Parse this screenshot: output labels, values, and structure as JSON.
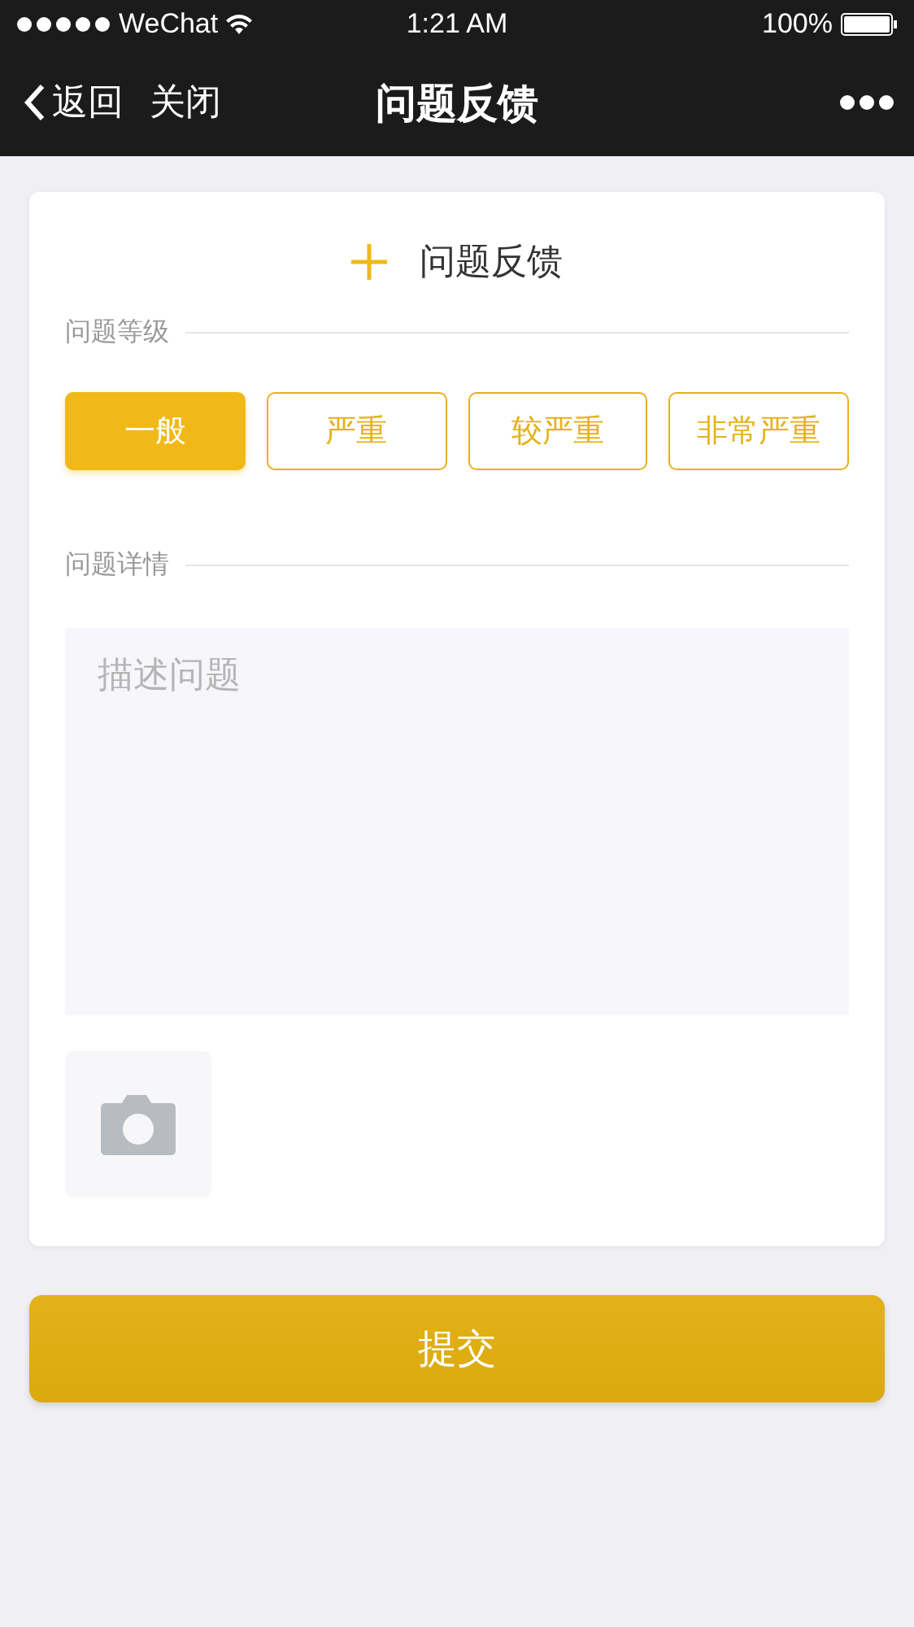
{
  "status_bar": {
    "carrier": "WeChat",
    "time": "1:21 AM",
    "battery": "100%"
  },
  "nav": {
    "back": "返回",
    "close": "关闭",
    "title": "问题反馈"
  },
  "form": {
    "heading": "问题反馈",
    "level_label": "问题等级",
    "levels": [
      {
        "label": "一般",
        "selected": true
      },
      {
        "label": "严重",
        "selected": false
      },
      {
        "label": "较严重",
        "selected": false
      },
      {
        "label": "非常严重",
        "selected": false
      }
    ],
    "detail_label": "问题详情",
    "detail_placeholder": "描述问题"
  },
  "submit": "提交"
}
